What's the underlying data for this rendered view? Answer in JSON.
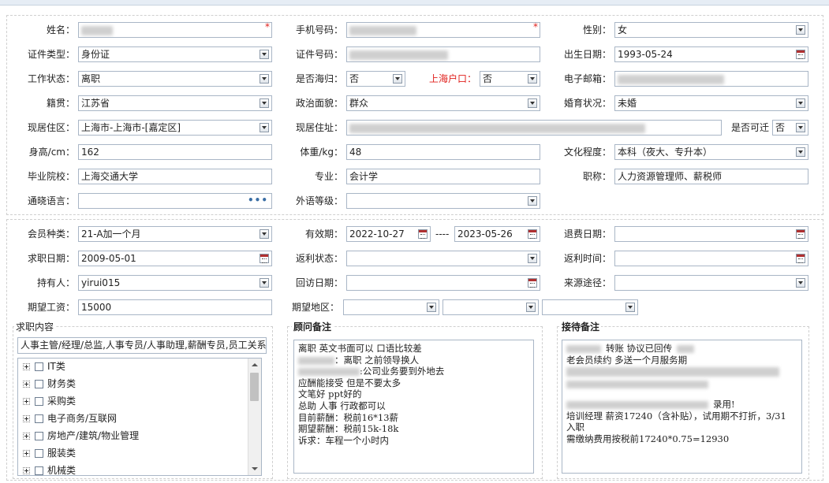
{
  "form1": {
    "name": {
      "label": "姓名："
    },
    "phone": {
      "label": "手机号码："
    },
    "gender": {
      "label": "性别：",
      "value": "女"
    },
    "id_type": {
      "label": "证件类型：",
      "value": "身份证"
    },
    "id_no": {
      "label": "证件号码："
    },
    "birth": {
      "label": "出生日期：",
      "value": "1993-05-24"
    },
    "work_status": {
      "label": "工作状态：",
      "value": "离职"
    },
    "overseas": {
      "label": "是否海归：",
      "value": "否"
    },
    "sh_hukou": {
      "label": "上海户口：",
      "value": "否"
    },
    "email": {
      "label": "电子邮箱："
    },
    "native": {
      "label": "籍贯：",
      "value": "江苏省"
    },
    "politics": {
      "label": "政治面貌：",
      "value": "群众"
    },
    "marital": {
      "label": "婚育状况：",
      "value": "未婚"
    },
    "residence_area": {
      "label": "现居住区：",
      "value": "上海市-上海市-[嘉定区]"
    },
    "residence_addr": {
      "label": "现居住址："
    },
    "relocate": {
      "label": "是否可迁",
      "value": "否"
    },
    "height": {
      "label": "身高/cm：",
      "value": "162"
    },
    "weight": {
      "label": "体重/kg：",
      "value": "48"
    },
    "education": {
      "label": "文化程度：",
      "value": "本科（夜大、专升本）"
    },
    "school": {
      "label": "毕业院校：",
      "value": "上海交通大学"
    },
    "major": {
      "label": "专业：",
      "value": "会计学"
    },
    "title": {
      "label": "职称：",
      "value": "人力资源管理师、薪税师"
    },
    "language": {
      "label": "通晓语言：",
      "dots": "•••"
    },
    "foreign_level": {
      "label": "外语等级："
    },
    "required_mark": "*"
  },
  "form2": {
    "member_type": {
      "label": "会员种类：",
      "value": "21-A加一个月"
    },
    "valid": {
      "label": "有效期：",
      "from": "2022-10-27",
      "sep": "----",
      "to": "2023-05-26"
    },
    "refund_date": {
      "label": "退费日期："
    },
    "job_date": {
      "label": "求职日期：",
      "value": "2009-05-01"
    },
    "rebate_status": {
      "label": "返利状态："
    },
    "rebate_time": {
      "label": "返利时间："
    },
    "holder": {
      "label": "持有人：",
      "value": "yirui015"
    },
    "visit_date": {
      "label": "回访日期："
    },
    "source": {
      "label": "来源途径："
    },
    "salary": {
      "label": "期望工资：",
      "value": "15000"
    },
    "area": {
      "label": "期望地区："
    }
  },
  "job": {
    "title": "求职内容",
    "summary": "人事主管/经理/总监,人事专员/人事助理,薪酬专员,员工关系",
    "categories": [
      "IT类",
      "财务类",
      "采购类",
      "电子商务/互联网",
      "房地产/建筑/物业管理",
      "服装类",
      "机械类"
    ]
  },
  "advisor": {
    "title": "顾问备注",
    "lines": [
      "离职 英文书面可以 口语比较差",
      "：离职 之前领导换人",
      ":公司业务要到外地去",
      "应酬能接受 但是不要太多",
      "文笔好 ppt好的",
      "总助 人事 行政都可以",
      "目前薪酬：税前16*13薪",
      "期望薪酬：税前15k-18k",
      "诉求：车程一个小时内"
    ]
  },
  "reception": {
    "title": "接待备注",
    "lines": [
      "转账  协议已回传",
      "老会员续约  多送一个月服务期",
      "",
      "",
      "录用!",
      "培训经理  薪资17240（含补贴），试用期不打折，3/31",
      "入职",
      "需缴纳费用按税前17240*0.75=12930"
    ]
  }
}
